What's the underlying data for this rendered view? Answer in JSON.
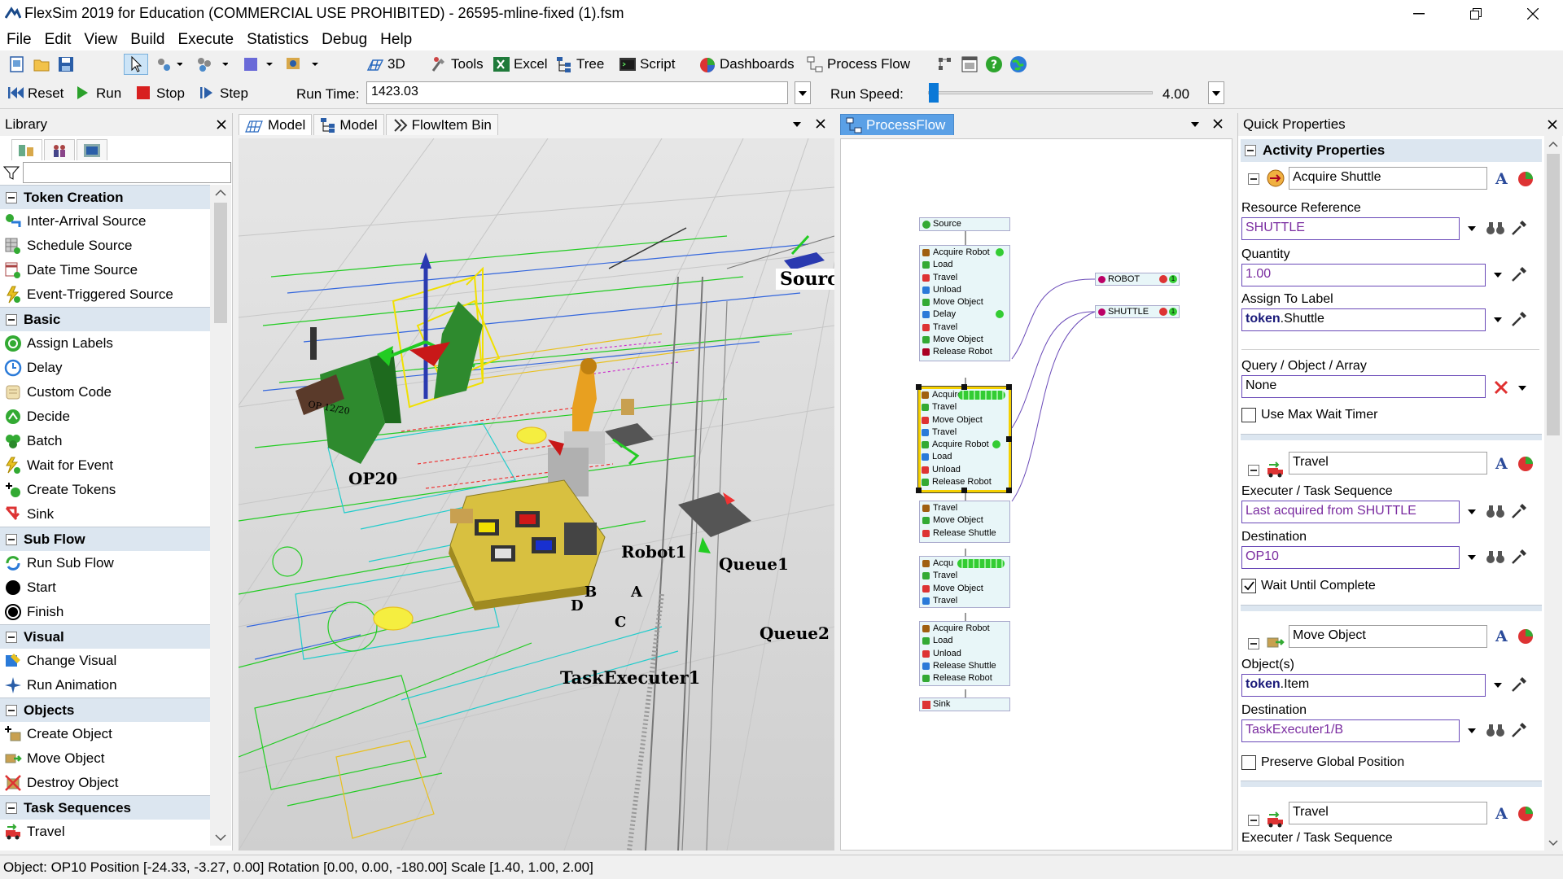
{
  "window": {
    "title": "FlexSim 2019 for Education (COMMERCIAL USE PROHIBITED) - 26595-mline-fixed (1).fsm"
  },
  "menu": [
    "File",
    "Edit",
    "View",
    "Build",
    "Execute",
    "Statistics",
    "Debug",
    "Help"
  ],
  "toolbar": {
    "btn_3d": "3D",
    "tools": "Tools",
    "excel": "Excel",
    "tree": "Tree",
    "script": "Script",
    "dashboards": "Dashboards",
    "process_flow": "Process Flow"
  },
  "run": {
    "reset": "Reset",
    "run": "Run",
    "stop": "Stop",
    "step": "Step",
    "run_time_label": "Run Time:",
    "run_time": "1423.03",
    "run_speed_label": "Run Speed:",
    "run_speed": "4.00"
  },
  "library": {
    "title": "Library",
    "groups": [
      {
        "name": "Token Creation",
        "items": [
          "Inter-Arrival Source",
          "Schedule Source",
          "Date Time Source",
          "Event-Triggered Source"
        ]
      },
      {
        "name": "Basic",
        "items": [
          "Assign Labels",
          "Delay",
          "Custom Code",
          "Decide",
          "Batch",
          "Wait for Event",
          "Create Tokens",
          "Sink"
        ]
      },
      {
        "name": "Sub Flow",
        "items": [
          "Run Sub Flow",
          "Start",
          "Finish"
        ]
      },
      {
        "name": "Visual",
        "items": [
          "Change Visual",
          "Run Animation"
        ]
      },
      {
        "name": "Objects",
        "items": [
          "Create Object",
          "Move Object",
          "Destroy Object"
        ]
      },
      {
        "name": "Task Sequences",
        "items": [
          "Travel"
        ]
      }
    ]
  },
  "tabs": {
    "model1": "Model",
    "model2": "Model",
    "flowitem_bin": "FlowItem Bin",
    "processflow": "ProcessFlow"
  },
  "scene_labels": {
    "source": "Source",
    "op20": "OP20",
    "op_small": "OP  12/20",
    "robot1": "Robot1",
    "queue1": "Queue1",
    "queue2": "Queue2",
    "task_executer": "TaskExecuter1",
    "b": "B",
    "a": "A",
    "d": "D",
    "c": "C"
  },
  "processflow": {
    "source": "Source",
    "block1": [
      "Acquire Robot",
      "Load",
      "Travel",
      "Unload",
      "Move Object",
      "Delay",
      "Travel",
      "Move Object",
      "Release Robot"
    ],
    "block2": [
      "Acquire",
      "Travel",
      "Move Object",
      "Travel",
      "Acquire Robot",
      "Load",
      "Unload",
      "Release Robot"
    ],
    "block3": [
      "Travel",
      "Move Object",
      "Release Shuttle"
    ],
    "block4": [
      "Acqu",
      "Travel",
      "Move Object",
      "Travel"
    ],
    "block5": [
      "Acquire Robot",
      "Load",
      "Unload",
      "Release Shuttle",
      "Release Robot"
    ],
    "sink": "Sink",
    "resource_robot": "ROBOT",
    "resource_shuttle": "SHUTTLE",
    "res_count": "1"
  },
  "quick_properties": {
    "title": "Quick Properties",
    "section": "Activity Properties",
    "acquire": {
      "name": "Acquire Shuttle",
      "resource_reference_label": "Resource Reference",
      "resource_reference": "SHUTTLE",
      "quantity_label": "Quantity",
      "quantity": "1.00",
      "assign_label": "Assign To Label",
      "assign_value_bold": "token",
      "assign_value_rest": ".Shuttle",
      "query_label": "Query / Object / Array",
      "query_value": "None",
      "max_wait": "Use Max Wait Timer"
    },
    "travel1": {
      "name": "Travel",
      "executer_label": "Executer / Task Sequence",
      "executer": "Last acquired from SHUTTLE",
      "destination_label": "Destination",
      "destination": "OP10",
      "wait": "Wait Until Complete"
    },
    "move": {
      "name": "Move Object",
      "objects_label": "Object(s)",
      "objects_bold": "token",
      "objects_rest": ".Item",
      "destination_label": "Destination",
      "destination": "TaskExecuter1/B",
      "preserve": "Preserve Global Position"
    },
    "travel2": {
      "name": "Travel",
      "executer_label": "Executer / Task Sequence"
    }
  },
  "status": "Object: OP10 Position [-24.33, -3.27, 0.00]  Rotation [0.00, 0.00, -180.00]  Scale [1.40, 1.00, 2.00]",
  "colors": {
    "header": "#dce6f0",
    "accent_blue": "#5aa0e6",
    "purple_text": "#7a2ca0",
    "selection": "#f5d000"
  }
}
